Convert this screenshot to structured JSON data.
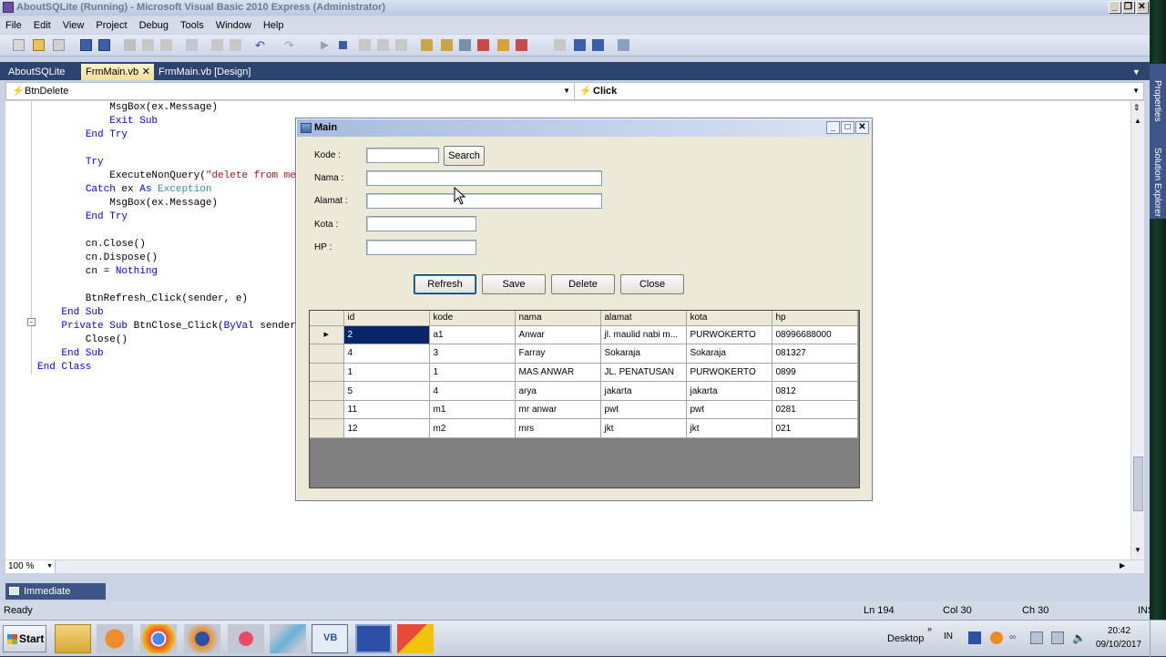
{
  "window": {
    "title": "AboutSQLite (Running) - Microsoft Visual Basic 2010 Express (Administrator)"
  },
  "menu": [
    "File",
    "Edit",
    "View",
    "Project",
    "Debug",
    "Tools",
    "Window",
    "Help"
  ],
  "tabs": [
    {
      "label": "AboutSQLite"
    },
    {
      "label": "FrmMain.vb",
      "active": true,
      "close": "✕"
    },
    {
      "label": "FrmMain.vb [Design]"
    }
  ],
  "dropdowns": {
    "object": "BtnDelete",
    "event": "Click"
  },
  "code_lines": [
    "            MsgBox(ex.Message)",
    "            Exit Sub",
    "        End Try",
    "",
    "        Try",
    "            ExecuteNonQuery(\"delete from me",
    "        Catch ex As Exception",
    "            MsgBox(ex.Message)",
    "        End Try",
    "",
    "        cn.Close()",
    "        cn.Dispose()",
    "        cn = Nothing",
    "",
    "        BtnRefresh_Click(sender, e)",
    "    End Sub",
    "    Private Sub BtnClose_Click(ByVal sender",
    "        Close()",
    "    End Sub",
    "End Class"
  ],
  "zoom": "100 %",
  "immediate_window": "Immediate Window",
  "status": {
    "left": "Ready",
    "ln": "Ln 194",
    "col": "Col 30",
    "ch": "Ch 30",
    "mode": "INS"
  },
  "side_panels": {
    "properties": "Properties",
    "solution_explorer": "Solution Explorer"
  },
  "dialog": {
    "title": "Main",
    "labels": {
      "kode": "Kode :",
      "nama": "Nama :",
      "alamat": "Alamat :",
      "kota": "Kota :",
      "hp": "HP :"
    },
    "search_button": "Search",
    "buttons": {
      "refresh": "Refresh",
      "save": "Save",
      "delete": "Delete",
      "close": "Close"
    },
    "grid": {
      "columns": [
        "id",
        "kode",
        "nama",
        "alamat",
        "kota",
        "hp"
      ],
      "rows": [
        [
          "2",
          "a1",
          "Anwar",
          "jl. maulid nabi m...",
          "PURWOKERTO",
          "08996688000"
        ],
        [
          "4",
          "3",
          "Farray",
          "Sokaraja",
          "Sokaraja",
          "081327"
        ],
        [
          "1",
          "1",
          "MAS ANWAR",
          "JL. PENATUSAN",
          "PURWOKERTO",
          "0899"
        ],
        [
          "5",
          "4",
          "arya",
          "jakarta",
          "jakarta",
          "0812"
        ],
        [
          "11",
          "m1",
          "mr anwar",
          "pwt",
          "pwt",
          "0281"
        ],
        [
          "12",
          "m2",
          "mrs",
          "jkt",
          "jkt",
          "021"
        ]
      ],
      "current_row_marker": "▶"
    }
  },
  "taskbar": {
    "start": "Start",
    "desktop": "Desktop",
    "lang": "IN",
    "time": "20:42",
    "date": "09/10/2017"
  }
}
